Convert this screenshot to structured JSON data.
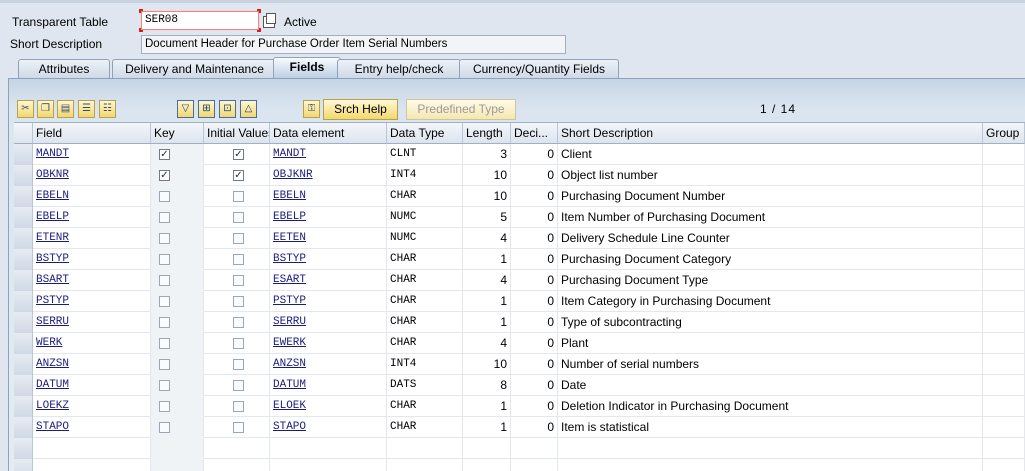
{
  "header": {
    "table_label": "Transparent Table",
    "table_value": "SER08",
    "status": "Active",
    "desc_label": "Short Description",
    "desc_value": "Document Header for Purchase Order Item Serial Numbers"
  },
  "tabs": [
    {
      "label": "Attributes"
    },
    {
      "label": "Delivery and Maintenance"
    },
    {
      "label": "Fields"
    },
    {
      "label": "Entry help/check"
    },
    {
      "label": "Currency/Quantity Fields"
    }
  ],
  "toolbar": {
    "icons": [
      "cut-icon",
      "copy-icon",
      "paste-icon",
      "insert-row-icon",
      "delete-row-icon",
      "sort-desc-icon",
      "append-icon",
      "insert-icon",
      "sort-asc-icon",
      "key-icon"
    ],
    "srch_help": "Srch Help",
    "predefined_type": "Predefined Type",
    "pager": "1 / 14"
  },
  "columns": [
    "Field",
    "Key",
    "Initial Values",
    "Data element",
    "Data Type",
    "Length",
    "Deci...",
    "Short Description",
    "Group"
  ],
  "rows": [
    {
      "field": "MANDT",
      "key": true,
      "init": true,
      "de": "MANDT",
      "type": "CLNT",
      "len": "3",
      "dec": "0",
      "desc": "Client"
    },
    {
      "field": "OBKNR",
      "key": true,
      "init": true,
      "de": "OBJKNR",
      "type": "INT4",
      "len": "10",
      "dec": "0",
      "desc": "Object list number"
    },
    {
      "field": "EBELN",
      "key": false,
      "init": false,
      "de": "EBELN",
      "type": "CHAR",
      "len": "10",
      "dec": "0",
      "desc": "Purchasing Document Number"
    },
    {
      "field": "EBELP",
      "key": false,
      "init": false,
      "de": "EBELP",
      "type": "NUMC",
      "len": "5",
      "dec": "0",
      "desc": "Item Number of Purchasing Document"
    },
    {
      "field": "ETENR",
      "key": false,
      "init": false,
      "de": "EETEN",
      "type": "NUMC",
      "len": "4",
      "dec": "0",
      "desc": "Delivery Schedule Line Counter"
    },
    {
      "field": "BSTYP",
      "key": false,
      "init": false,
      "de": "BSTYP",
      "type": "CHAR",
      "len": "1",
      "dec": "0",
      "desc": "Purchasing Document Category"
    },
    {
      "field": "BSART",
      "key": false,
      "init": false,
      "de": "ESART",
      "type": "CHAR",
      "len": "4",
      "dec": "0",
      "desc": "Purchasing Document Type"
    },
    {
      "field": "PSTYP",
      "key": false,
      "init": false,
      "de": "PSTYP",
      "type": "CHAR",
      "len": "1",
      "dec": "0",
      "desc": "Item Category in Purchasing Document"
    },
    {
      "field": "SERRU",
      "key": false,
      "init": false,
      "de": "SERRU",
      "type": "CHAR",
      "len": "1",
      "dec": "0",
      "desc": "Type of subcontracting"
    },
    {
      "field": "WERK",
      "key": false,
      "init": false,
      "de": "EWERK",
      "type": "CHAR",
      "len": "4",
      "dec": "0",
      "desc": "Plant"
    },
    {
      "field": "ANZSN",
      "key": false,
      "init": false,
      "de": "ANZSN",
      "type": "INT4",
      "len": "10",
      "dec": "0",
      "desc": "Number of serial numbers"
    },
    {
      "field": "DATUM",
      "key": false,
      "init": false,
      "de": "DATUM",
      "type": "DATS",
      "len": "8",
      "dec": "0",
      "desc": "Date"
    },
    {
      "field": "LOEKZ",
      "key": false,
      "init": false,
      "de": "ELOEK",
      "type": "CHAR",
      "len": "1",
      "dec": "0",
      "desc": "Deletion Indicator in Purchasing Document"
    },
    {
      "field": "STAPO",
      "key": false,
      "init": false,
      "de": "STAPO",
      "type": "CHAR",
      "len": "1",
      "dec": "0",
      "desc": "Item is statistical"
    }
  ],
  "empty_rows": 2
}
